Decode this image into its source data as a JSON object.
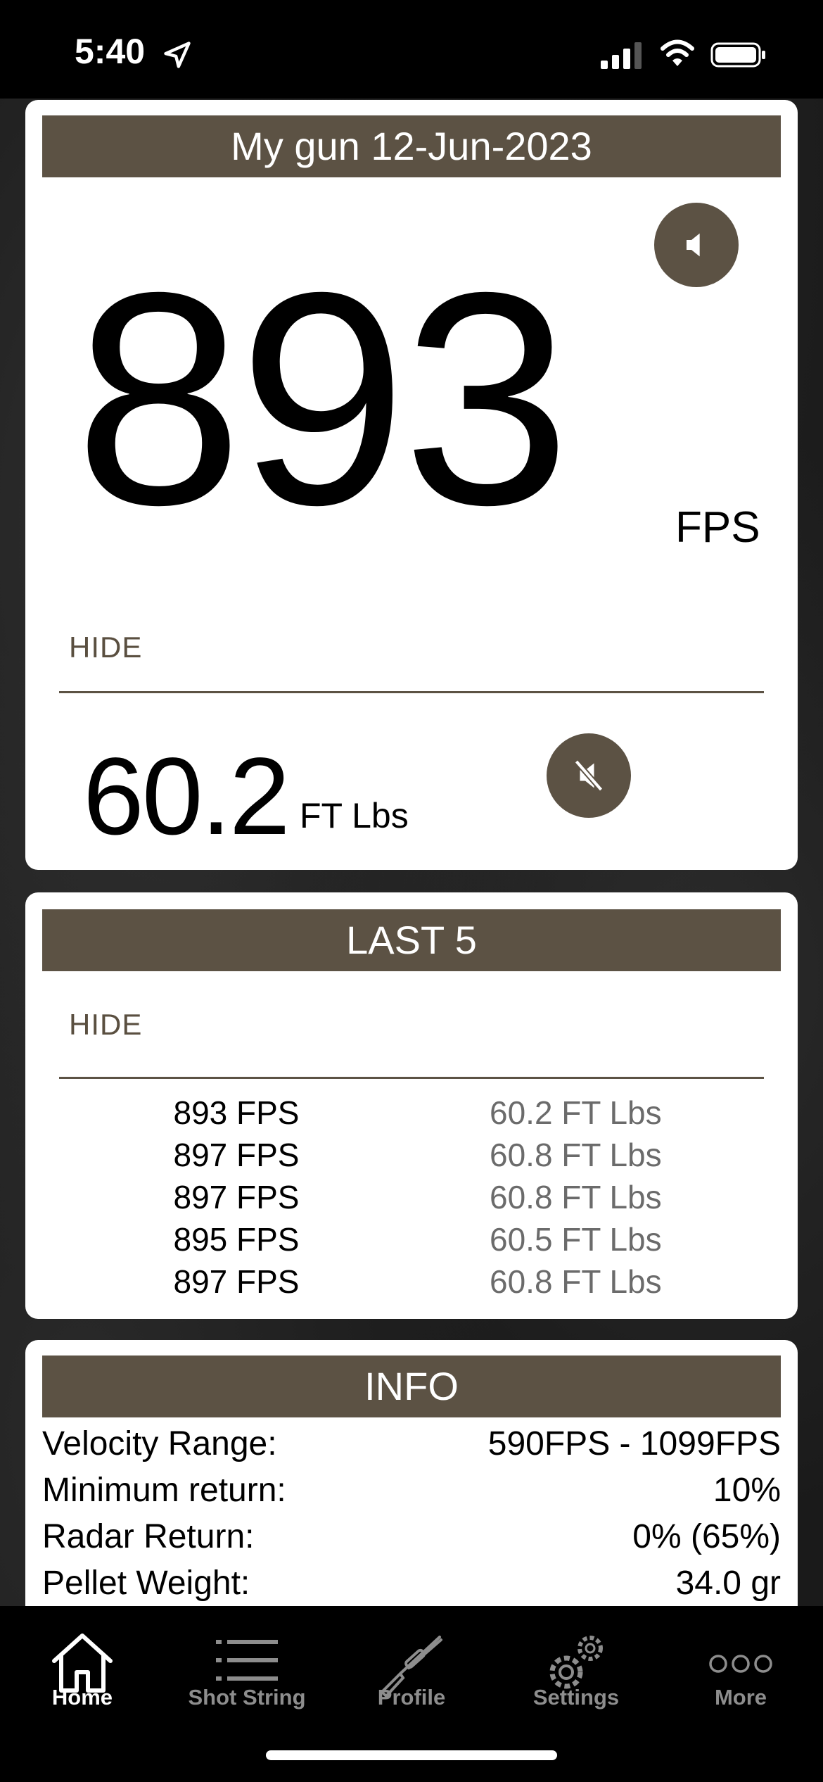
{
  "status": {
    "time": "5:40"
  },
  "main_card": {
    "title": "My gun 12-Jun-2023",
    "speed": "893",
    "speed_unit": "FPS",
    "hide_label": "HIDE",
    "energy": "60.2",
    "energy_unit": "FT Lbs"
  },
  "last5": {
    "title": "LAST 5",
    "hide_label": "HIDE",
    "rows": [
      {
        "fps": "893 FPS",
        "ft": "60.2 FT Lbs"
      },
      {
        "fps": "897 FPS",
        "ft": "60.8 FT Lbs"
      },
      {
        "fps": "897 FPS",
        "ft": "60.8 FT Lbs"
      },
      {
        "fps": "895 FPS",
        "ft": "60.5 FT Lbs"
      },
      {
        "fps": "897 FPS",
        "ft": "60.8 FT Lbs"
      }
    ]
  },
  "info": {
    "title": "INFO",
    "rows": [
      {
        "label": "Velocity Range:",
        "value": "590FPS - 1099FPS"
      },
      {
        "label": "Minimum return:",
        "value": "10%"
      },
      {
        "label": "Radar Return:",
        "value": "0%  (65%)"
      },
      {
        "label": "Pellet Weight:",
        "value": "34.0 gr"
      }
    ]
  },
  "tabs": [
    {
      "label": "Home",
      "icon": "home-icon",
      "active": true
    },
    {
      "label": "Shot String",
      "icon": "list-icon",
      "active": false
    },
    {
      "label": "Profile",
      "icon": "rifle-icon",
      "active": false
    },
    {
      "label": "Settings",
      "icon": "gear-icon",
      "active": false
    },
    {
      "label": "More",
      "icon": "more-icon",
      "active": false
    }
  ],
  "colors": {
    "accent": "#5c5244",
    "tab_active": "#ffffff",
    "tab_inactive": "#8d8d8d"
  }
}
